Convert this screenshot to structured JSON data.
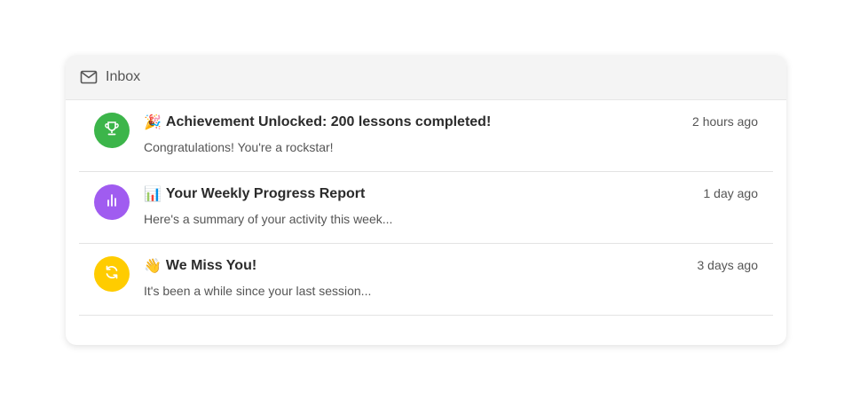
{
  "inbox": {
    "title": "Inbox",
    "icon": "mail-icon"
  },
  "messages": [
    {
      "emoji": "🎉",
      "title": "Achievement Unlocked: 200 lessons completed!",
      "subtitle": "Congratulations! You're a rockstar!",
      "time": "2 hours ago",
      "icon": "trophy-icon",
      "color": "#3cb54a"
    },
    {
      "emoji": "📊",
      "title": "Your Weekly Progress Report",
      "subtitle": "Here's a summary of your activity this week...",
      "time": "1 day ago",
      "icon": "bar-chart-icon",
      "color": "#a05cf0"
    },
    {
      "emoji": "👋",
      "title": "We Miss You!",
      "subtitle": "It's been a while since your last session...",
      "time": "3 days ago",
      "icon": "refresh-icon",
      "color": "#ffcc00"
    }
  ]
}
